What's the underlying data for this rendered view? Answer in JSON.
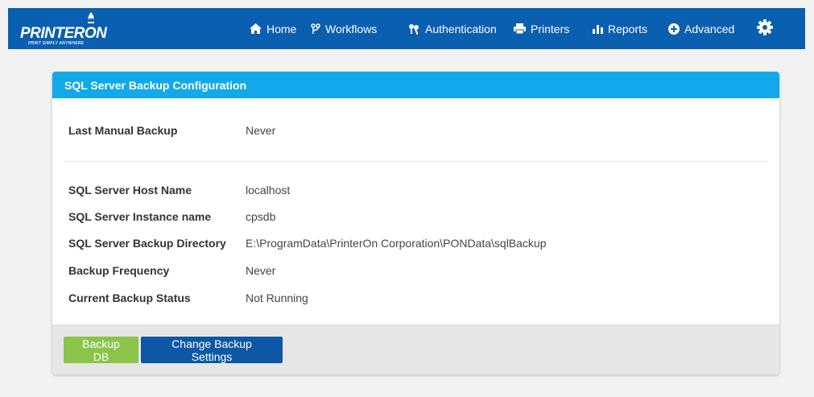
{
  "app": {
    "logo_text": "PRINTERON",
    "logo_tagline": "PRINT SIMPLY ANYWHERE"
  },
  "nav": {
    "items": [
      {
        "label": "Home",
        "icon": "home-icon"
      },
      {
        "label": "Workflows",
        "icon": "workflow-icon"
      },
      {
        "label": "Authentication",
        "icon": "keys-icon"
      },
      {
        "label": "Printers",
        "icon": "printer-icon"
      },
      {
        "label": "Reports",
        "icon": "bar-chart-icon"
      },
      {
        "label": "Advanced",
        "icon": "plus-circle-icon"
      }
    ],
    "settings_icon": "gear-icon"
  },
  "panel": {
    "title": "SQL Server Backup Configuration",
    "last_backup": {
      "label": "Last Manual Backup",
      "value": "Never"
    },
    "fields": [
      {
        "label": "SQL Server Host Name",
        "value": "localhost"
      },
      {
        "label": "SQL Server Instance name",
        "value": "cpsdb"
      },
      {
        "label": "SQL Server Backup Directory",
        "value": "E:\\ProgramData\\PrinterOn Corporation\\PONData\\sqlBackup"
      },
      {
        "label": "Backup Frequency",
        "value": "Never"
      },
      {
        "label": "Current Backup Status",
        "value": "Not Running"
      }
    ]
  },
  "buttons": {
    "backup_db": "Backup DB",
    "change_settings": "Change Backup Settings"
  },
  "colors": {
    "navbar": "#0b5fb0",
    "panel_header": "#12a9ea",
    "btn_green": "#8cc34a",
    "btn_blue": "#0c58a4"
  }
}
